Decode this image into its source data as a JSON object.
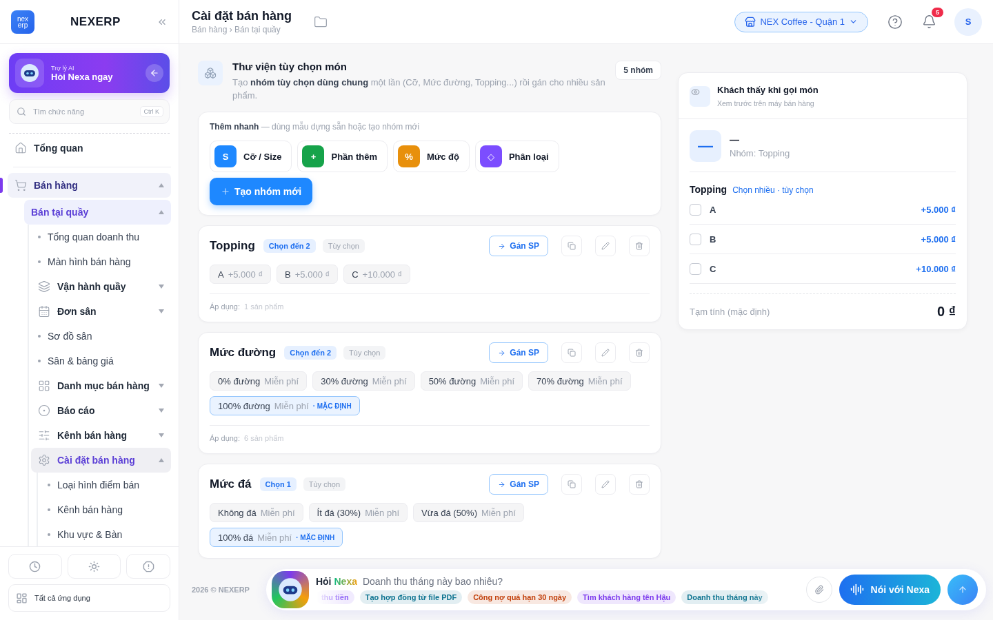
{
  "sidebar": {
    "brand": "NEXERP",
    "logo": [
      "nex",
      "erp"
    ],
    "ai_card": {
      "caption": "Trợ lý AI",
      "title": "Hỏi Nexa ngay"
    },
    "search": {
      "placeholder": "Tìm chức năng",
      "shortcut": "Ctrl K"
    },
    "nav": [
      {
        "label": "Tổng quan",
        "kind": "link",
        "selected": false
      },
      {
        "label": "Bán hàng",
        "kind": "group",
        "selected": true,
        "expanded": true,
        "children": [
          {
            "label": "Bán tại quầy",
            "kind": "group",
            "selected": true,
            "expanded": true,
            "children": [
              {
                "label": "Tổng quan doanh thu",
                "kind": "leaf",
                "selected": false
              },
              {
                "label": "Màn hình bán hàng",
                "kind": "leaf",
                "selected": false
              },
              {
                "label": "Vận hành quầy",
                "kind": "group",
                "selected": false,
                "expanded": false
              },
              {
                "label": "Đơn sân",
                "kind": "group",
                "selected": false,
                "expanded": false
              },
              {
                "label": "Sơ đồ sân",
                "kind": "leaf",
                "selected": false
              },
              {
                "label": "Sân & bảng giá",
                "kind": "leaf",
                "selected": false
              },
              {
                "label": "Danh mục bán hàng",
                "kind": "group",
                "selected": false,
                "expanded": false
              },
              {
                "label": "Báo cáo",
                "kind": "group",
                "selected": false,
                "expanded": false
              },
              {
                "label": "Kênh bán hàng",
                "kind": "group",
                "selected": false,
                "expanded": false
              },
              {
                "label": "Cài đặt bán hàng",
                "kind": "group",
                "selected": true,
                "expanded": true,
                "children": [
                  {
                    "label": "Loại hình điểm bán",
                    "kind": "leaf",
                    "selected": false
                  },
                  {
                    "label": "Kênh bán hàng",
                    "kind": "leaf",
                    "selected": false
                  },
                  {
                    "label": "Khu vực & Bàn",
                    "kind": "leaf",
                    "selected": false
                  }
                ]
              }
            ]
          }
        ]
      }
    ],
    "all_apps": "Tất cả ứng dụng"
  },
  "header": {
    "title": "Cài đặt bán hàng",
    "breadcrumb": "Bán hàng › Bán tại quầy",
    "branch": "NEX Coffee - Quận 1",
    "notifications": "5",
    "avatar": "S"
  },
  "intro": {
    "title": "Thư viện tùy chọn món",
    "description": "Tạo **nhóm tùy chọn dùng chung** một lần (Cỡ, Mức đường, Topping...) rồi gán cho nhiều sản phẩm.",
    "count": "5 nhóm"
  },
  "quick_add": {
    "hint": "**Thêm nhanh** — dùng mẫu dựng sẵn hoặc tạo nhóm mới",
    "templates": [
      {
        "glyph": "S",
        "label": "Cỡ / Size",
        "color": "#1e88ff"
      },
      {
        "glyph": "+",
        "label": "Phần thêm",
        "color": "#16a34a"
      },
      {
        "glyph": "%",
        "label": "Mức độ",
        "color": "#e8900c"
      },
      {
        "glyph": "◇",
        "label": "Phân loại",
        "color": "#7c4dff"
      }
    ],
    "create": "Tạo nhóm mới"
  },
  "groups": [
    {
      "name": "Topping",
      "limit": "Chọn đến 2",
      "requirement": "Tùy chọn",
      "assign": "Gán SP",
      "options": [
        {
          "name": "A",
          "price": "+5.000 ₫",
          "default": false
        },
        {
          "name": "B",
          "price": "+5.000 ₫",
          "default": false
        },
        {
          "name": "C",
          "price": "+10.000 ₫",
          "default": false
        }
      ],
      "applied_label": "Áp dụng:",
      "applied": "1 sản phẩm"
    },
    {
      "name": "Mức đường",
      "limit": "Chọn đến 2",
      "requirement": "Tùy chọn",
      "assign": "Gán SP",
      "options": [
        {
          "name": "0% đường",
          "price": "Miễn phí",
          "default": false
        },
        {
          "name": "30% đường",
          "price": "Miễn phí",
          "default": false
        },
        {
          "name": "50% đường",
          "price": "Miễn phí",
          "default": false
        },
        {
          "name": "70% đường",
          "price": "Miễn phí",
          "default": false
        },
        {
          "name": "100% đường",
          "price": "Miễn phí",
          "default": true,
          "tag": "· MẶC ĐỊNH"
        }
      ],
      "applied_label": "Áp dụng:",
      "applied": "6 sản phẩm"
    },
    {
      "name": "Mức đá",
      "limit": "Chọn 1",
      "requirement": "Tùy chọn",
      "assign": "Gán SP",
      "options": [
        {
          "name": "Không đá",
          "price": "Miễn phí",
          "default": false
        },
        {
          "name": "Ít đá (30%)",
          "price": "Miễn phí",
          "default": false
        },
        {
          "name": "Vừa đá (50%)",
          "price": "Miễn phí",
          "default": false
        },
        {
          "name": "100% đá",
          "price": "Miễn phí",
          "default": true,
          "tag": "· MẶC ĐỊNH"
        }
      ]
    }
  ],
  "preview": {
    "title": "Khách thấy khi gọi món",
    "subtitle": "Xem trước trên máy bán hàng",
    "thumb": "—",
    "product": "—",
    "group_line": "Nhóm: Topping",
    "section": "Topping",
    "section_hint": "Chọn nhiều · tùy chọn",
    "options": [
      {
        "name": "A",
        "price": "+5.000 ₫",
        "checked": false
      },
      {
        "name": "B",
        "price": "+5.000 ₫",
        "checked": false
      },
      {
        "name": "C",
        "price": "+10.000 ₫",
        "checked": false
      }
    ],
    "subtotal_label": "Tạm tính (mặc định)",
    "subtotal": "0 ₫"
  },
  "footer": {
    "copyright": "2026 © NEXERP",
    "ask": "Hỏi",
    "assistant": "Nexa",
    "prompt": "Doanh thu tháng này bao nhiêu?",
    "suggestions": [
      {
        "label": "thu tiền",
        "color": "#8b5cf6"
      },
      {
        "label": "Tạo hợp đồng từ file PDF",
        "color": "#0e7490"
      },
      {
        "label": "Công nợ quá hạn 30 ngày",
        "color": "#c2410c"
      },
      {
        "label": "Tìm khách hàng tên Hậu",
        "color": "#7c3aed"
      },
      {
        "label": "Doanh thu tháng này",
        "color": "#0e7490"
      }
    ],
    "voice": "Nói với Nexa"
  }
}
